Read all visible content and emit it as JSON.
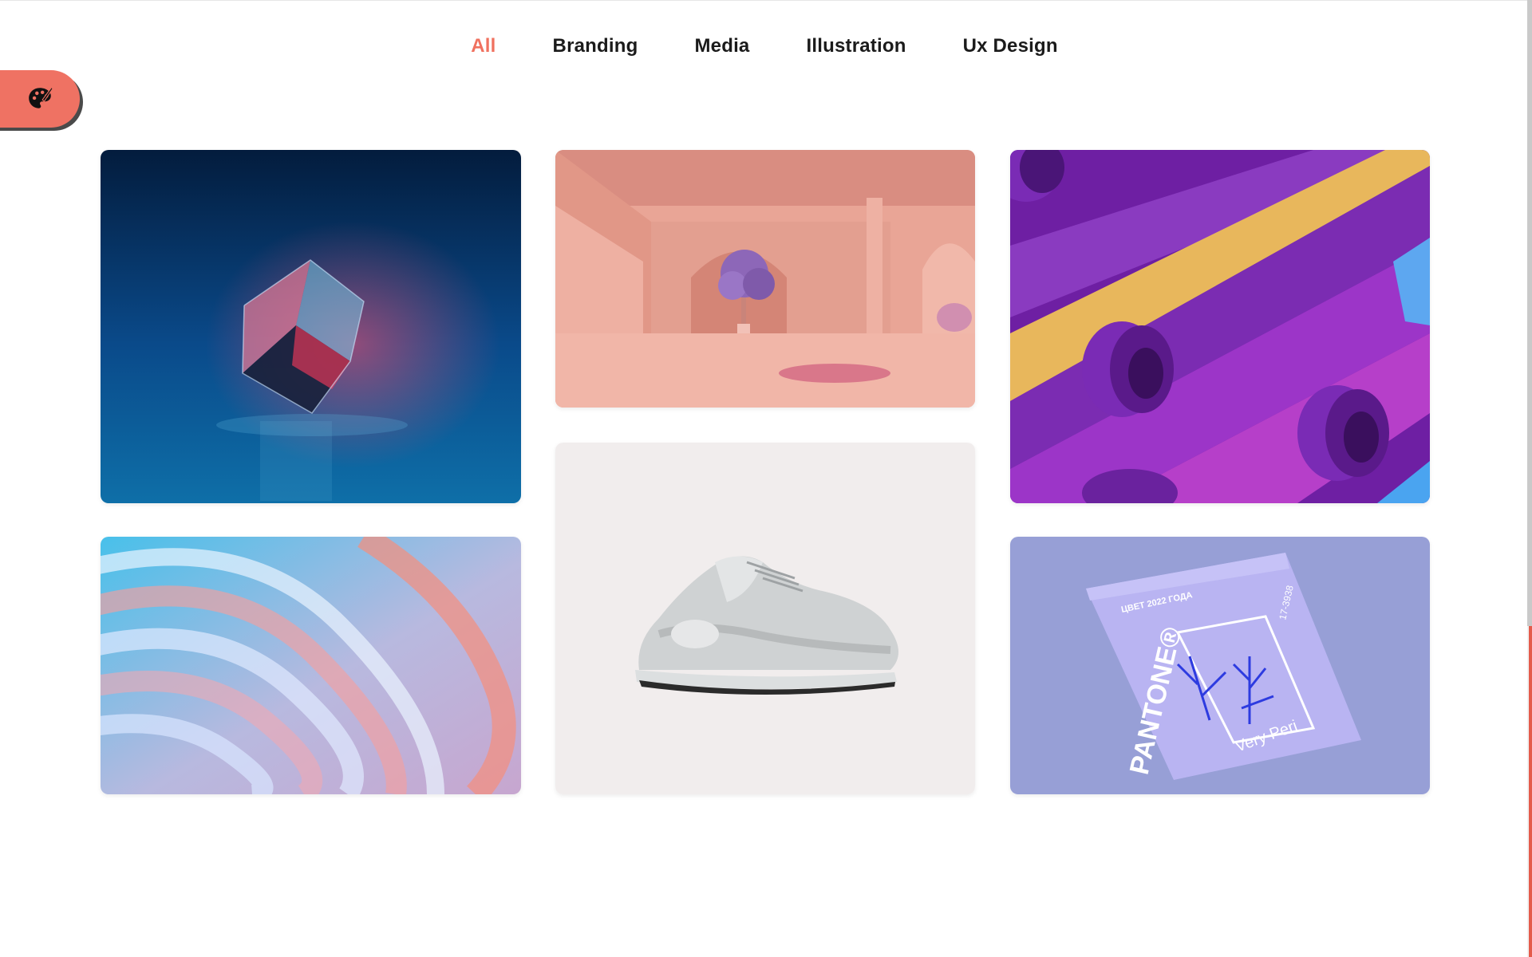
{
  "nav": {
    "tabs": [
      {
        "label": "All",
        "active": true
      },
      {
        "label": "Branding",
        "active": false
      },
      {
        "label": "Media",
        "active": false
      },
      {
        "label": "Illustration",
        "active": false
      },
      {
        "label": "Ux Design",
        "active": false
      }
    ]
  },
  "style_switcher": {
    "icon": "palette-icon",
    "color": "#ef7263"
  },
  "colors": {
    "accent": "#f0715f",
    "text": "#1b1b1b"
  },
  "gallery": {
    "items": [
      {
        "name": "crystal-cube"
      },
      {
        "name": "pastel-waves"
      },
      {
        "name": "pink-room"
      },
      {
        "name": "grey-sneaker"
      },
      {
        "name": "purple-rings"
      },
      {
        "name": "pantone-poster"
      }
    ]
  },
  "poster": {
    "brand": "PANTONE®",
    "caption": "Very Peri",
    "code": "17-3938",
    "header_ru": "ЦВЕТ 2022 ГОДА"
  }
}
